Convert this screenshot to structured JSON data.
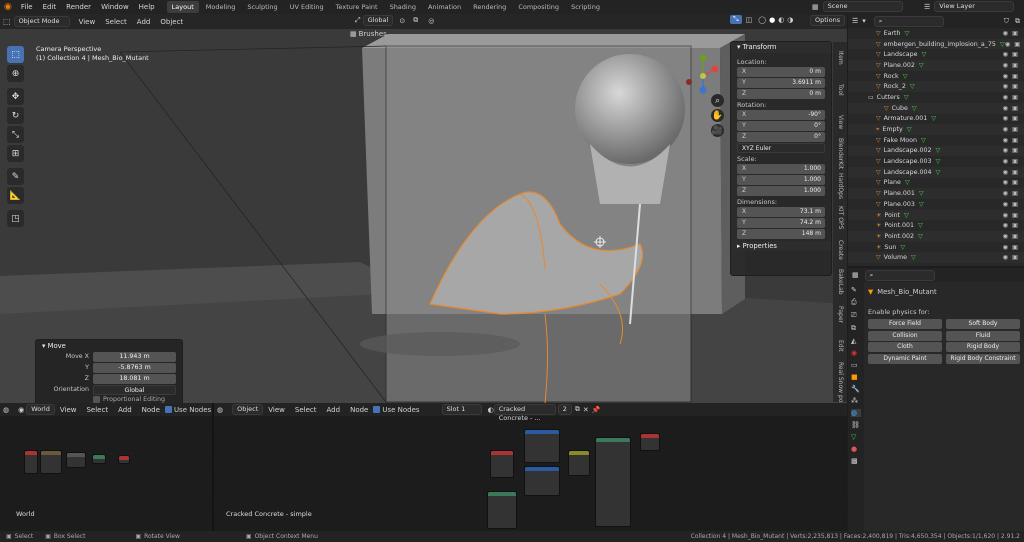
{
  "menubar": {
    "items": [
      "File",
      "Edit",
      "Render",
      "Window",
      "Help"
    ],
    "workspaces": [
      "Layout",
      "Modeling",
      "Sculpting",
      "UV Editing",
      "Texture Paint",
      "Shading",
      "Animation",
      "Rendering",
      "Compositing",
      "Scripting"
    ],
    "active_workspace": "Layout",
    "scene": "Scene",
    "view_layer": "View Layer"
  },
  "viewport": {
    "mode": "Object Mode",
    "menus": [
      "View",
      "Select",
      "Add",
      "Object"
    ],
    "transform_orientation": "Global",
    "options": "Options",
    "brushes": "Brushes",
    "camera_label": "Camera Perspective",
    "collection_label": "(1) Collection 4 | Mesh_Bio_Mutant"
  },
  "npanel": {
    "title": "Transform",
    "location_label": "Location:",
    "location": [
      {
        "k": "X",
        "v": "0 m"
      },
      {
        "k": "Y",
        "v": "3.6911 m"
      },
      {
        "k": "Z",
        "v": "0 m"
      }
    ],
    "rotation_label": "Rotation:",
    "rotation": [
      {
        "k": "X",
        "v": "-90°"
      },
      {
        "k": "Y",
        "v": "0°"
      },
      {
        "k": "Z",
        "v": "0°"
      }
    ],
    "rotation_mode": "XYZ Euler",
    "scale_label": "Scale:",
    "scale": [
      {
        "k": "X",
        "v": "1.000"
      },
      {
        "k": "Y",
        "v": "1.000"
      },
      {
        "k": "Z",
        "v": "1.000"
      }
    ],
    "dimensions_label": "Dimensions:",
    "dimensions": [
      {
        "k": "X",
        "v": "73.1 m"
      },
      {
        "k": "Y",
        "v": "74.2 m"
      },
      {
        "k": "Z",
        "v": "148 m"
      }
    ],
    "properties": "Properties"
  },
  "side_tabs": [
    "Item",
    "Tool",
    "View",
    "BlenderKit",
    "HardOps",
    "KIT OPS",
    "Create",
    "BakeLab",
    "Paper",
    "Edit",
    "Real Snow",
    "polygoniq"
  ],
  "move_panel": {
    "title": "Move",
    "rows": [
      {
        "k": "Move X",
        "v": "11.943 m"
      },
      {
        "k": "Y",
        "v": "-5.8763 m"
      },
      {
        "k": "Z",
        "v": "18.081 m"
      },
      {
        "k": "Orientation",
        "v": "Global"
      }
    ],
    "proportional": "Proportional Editing"
  },
  "outliner": {
    "rows": [
      "Earth",
      "embergen_building_implosion_a_75",
      "Landscape",
      "Plane.002",
      "Rock",
      "Rock_2",
      "Cutters",
      "Cube",
      "Armature.001",
      "Empty",
      "Fake Moon",
      "Landscape.002",
      "Landscape.003",
      "Landscape.004",
      "Plane",
      "Plane.001",
      "Plane.003",
      "Point",
      "Point.001",
      "Point.002",
      "Sun",
      "Volume"
    ]
  },
  "properties": {
    "object": "Mesh_Bio_Mutant",
    "enable_label": "Enable physics for:",
    "buttons": [
      [
        "Force Field",
        "Soft Body"
      ],
      [
        "Collision",
        "Fluid"
      ],
      [
        "Cloth",
        "Rigid Body"
      ],
      [
        "Dynamic Paint",
        "Rigid Body Constraint"
      ]
    ]
  },
  "node_left": {
    "type": "World",
    "menus": [
      "View",
      "Select",
      "Add",
      "Node"
    ],
    "use_nodes": "Use Nodes",
    "footer": "World"
  },
  "node_right": {
    "type": "Object",
    "menus": [
      "View",
      "Select",
      "Add",
      "Node"
    ],
    "use_nodes": "Use Nodes",
    "slot": "Slot 1",
    "material": "Cracked Concrete - ...",
    "users": "2",
    "footer": "Cracked Concrete - simple"
  },
  "statusbar": {
    "left": [
      "Select",
      "Box Select",
      "Rotate View",
      "Object Context Menu"
    ],
    "right": "Collection 4 | Mesh_Bio_Mutant | Verts:2,235,813 | Faces:2,400,819 | Tris:4,650,354 | Objects:1/1,620 | 2.91.2"
  }
}
